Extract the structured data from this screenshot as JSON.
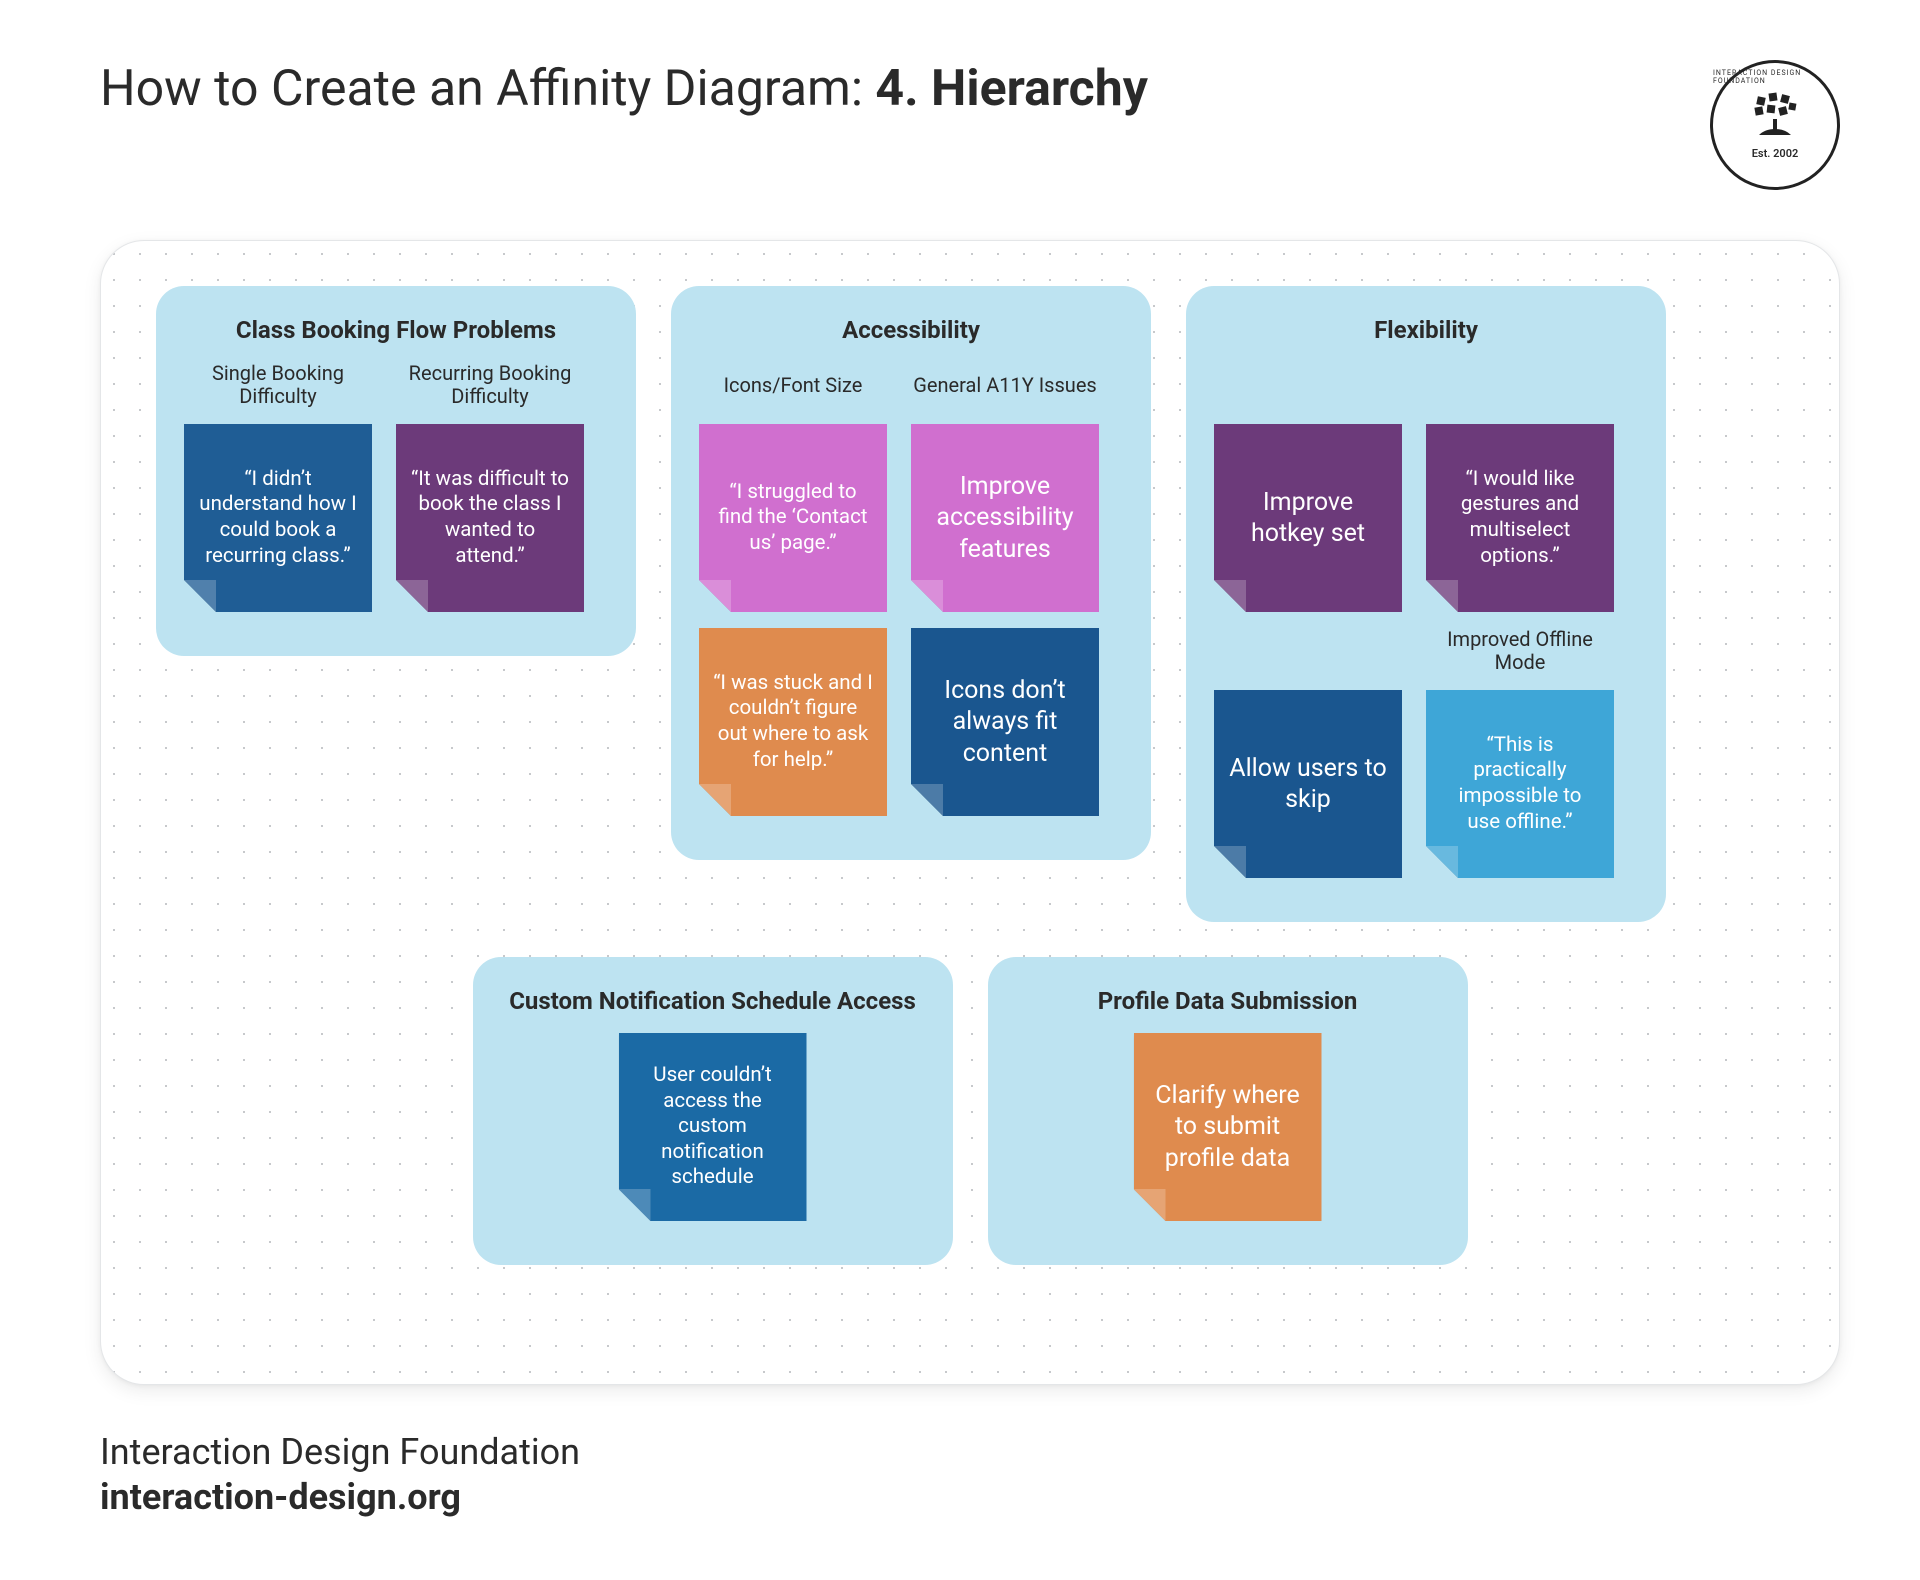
{
  "title_prefix": "How to Create an Affinity Diagram: ",
  "title_bold": "4. Hierarchy",
  "logo": {
    "est": "Est. 2002",
    "circ": "INTERACTION DESIGN FOUNDATION"
  },
  "clusters": {
    "booking": {
      "title": "Class Booking Flow Problems",
      "cols": [
        {
          "label": "Single Booking Difficulty",
          "notes": [
            {
              "text": "“I didn’t understand how I could book a recurring class.”",
              "color": "n-deepblue"
            }
          ]
        },
        {
          "label": "Recurring Booking Difficulty",
          "notes": [
            {
              "text": "“It was difficult to book the class I wanted to attend.”",
              "color": "n-purple"
            }
          ]
        }
      ]
    },
    "accessibility": {
      "title": "Accessibility",
      "cols": [
        {
          "label": "Icons/Font Size",
          "notes": [
            {
              "text": "“I struggled to find the ‘Contact us’ page.”",
              "color": "n-magenta"
            },
            {
              "text": "“I was stuck and I couldn’t figure out where to ask for help.”",
              "color": "n-orange"
            }
          ]
        },
        {
          "label": "General A11Y Issues",
          "notes": [
            {
              "text": "Improve accessibility features",
              "color": "n-magenta",
              "large": true
            },
            {
              "text": "Icons don’t always fit content",
              "color": "n-darkblue",
              "large": true
            }
          ]
        }
      ]
    },
    "flexibility": {
      "title": "Flexibility",
      "grid": [
        [
          {
            "label": "",
            "note": {
              "text": "Improve hotkey set",
              "color": "n-purple",
              "large": true
            }
          },
          {
            "label": "",
            "note": {
              "text": "“I would like gestures and multiselect options.”",
              "color": "n-purple"
            }
          }
        ],
        [
          {
            "label": "",
            "note": {
              "text": "Allow users to skip",
              "color": "n-darkblue",
              "large": true
            }
          },
          {
            "label": "Improved Offline Mode",
            "note": {
              "text": "“This is practically impossible to use offline.”",
              "color": "n-skyblue"
            }
          }
        ]
      ]
    },
    "notifications": {
      "title": "Custom Notification Schedule Access",
      "notes": [
        {
          "text": "User couldn’t access the custom notification schedule",
          "color": "n-blue"
        }
      ]
    },
    "profile": {
      "title": "Profile Data Submission",
      "notes": [
        {
          "text": "Clarify where to submit profile data",
          "color": "n-orange",
          "large": true
        }
      ]
    }
  },
  "footer": {
    "org": "Interaction Design Foundation",
    "url": "interaction-design.org"
  }
}
